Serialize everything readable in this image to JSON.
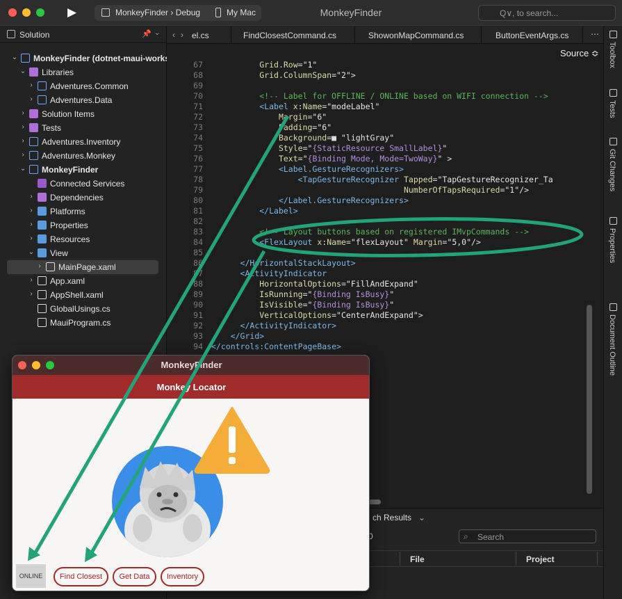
{
  "window": {
    "title": "MonkeyFinder",
    "config_project": "MonkeyFinder › Debug",
    "config_device": "My Mac",
    "search_placeholder": "Q∨, to search..."
  },
  "solution": {
    "header": "Solution",
    "items": [
      {
        "label": "MonkeyFinder (dotnet-maui-works",
        "bold": true
      },
      {
        "label": "Libraries"
      },
      {
        "label": "Adventures.Common"
      },
      {
        "label": "Adventures.Data"
      },
      {
        "label": "Solution Items"
      },
      {
        "label": "Tests"
      },
      {
        "label": "Adventures.Inventory"
      },
      {
        "label": "Adventures.Monkey"
      },
      {
        "label": "MonkeyFinder",
        "bold": true
      },
      {
        "label": "Connected Services"
      },
      {
        "label": "Dependencies"
      },
      {
        "label": "Platforms"
      },
      {
        "label": "Properties"
      },
      {
        "label": "Resources"
      },
      {
        "label": "View"
      },
      {
        "label": "MainPage.xaml",
        "selected": true
      },
      {
        "label": "App.xaml"
      },
      {
        "label": "AppShell.xaml"
      },
      {
        "label": "GlobalUsings.cs"
      },
      {
        "label": "MauiProgram.cs"
      }
    ]
  },
  "tabs": [
    {
      "label": "el.cs"
    },
    {
      "label": "FindClosestCommand.cs"
    },
    {
      "label": "ShowonMapCommand.cs"
    },
    {
      "label": "ButtonEventArgs.cs"
    }
  ],
  "editor": {
    "source_label": "Source ≎",
    "line_numbers": [
      "67",
      "68",
      "69",
      "70",
      "71",
      "72",
      "73",
      "74",
      "75",
      "76",
      "77",
      "78",
      "79",
      "80",
      "81",
      "82",
      "83",
      "84",
      "85",
      "86",
      "87",
      "88",
      "89",
      "90",
      "91",
      "92",
      "93",
      "94"
    ]
  },
  "right_dock": [
    {
      "label": "Toolbox",
      "icon": "toolbox-icon"
    },
    {
      "label": "Tests",
      "icon": "tests-icon"
    },
    {
      "label": "Git Changes",
      "icon": "git-icon"
    },
    {
      "label": "Properties",
      "icon": "properties-icon"
    },
    {
      "label": "Document Outline",
      "icon": "outline-icon"
    }
  ],
  "bottom_pad": {
    "tab": "ch Results",
    "count": "0",
    "search_placeholder": "Search",
    "columns": [
      "File",
      "Project"
    ]
  },
  "simulator": {
    "title": "MonkeyFinder",
    "nav_title": "Monkey Locator",
    "status": "ONLINE",
    "buttons": [
      "Find Closest",
      "Get Data",
      "Inventory"
    ]
  },
  "colors": {
    "nav_bar": "#a12a2a",
    "annotation": "#22a37a",
    "warning": "#f5ad3a"
  }
}
